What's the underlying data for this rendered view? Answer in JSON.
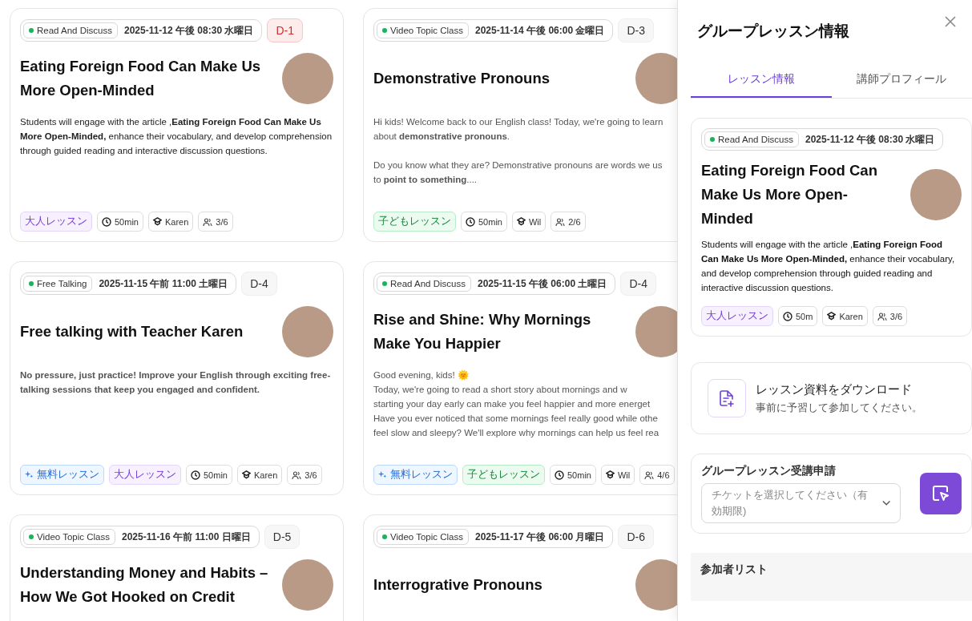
{
  "cards": [
    {
      "type": "Read And Discuss",
      "datetime": "2025-11-12 午後 08:30 水曜日",
      "countdown": "D-1",
      "urgent": true,
      "title": "Eating Foreign Food Can Make Us More Open-Minded",
      "emphasis": false,
      "paragraphs": [
        "Students will engage with the article ,**Eating Foreign Food Can Make Us More Open-Minded,** enhance  their vocabulary, and develop comprehension through guided reading and interactive discussion questions."
      ],
      "tags": [
        {
          "kind": "adult",
          "label": "大人レッスン"
        }
      ],
      "duration": "50min",
      "teacher": "Karen",
      "capacity": "3/6"
    },
    {
      "type": "Video Topic Class",
      "datetime": "2025-11-14 午後 06:00 金曜日",
      "countdown": "D-3",
      "urgent": false,
      "title": "Demonstrative Pronouns",
      "emphasis": false,
      "paragraphs": [
        "Hi kids! Welcome back to our English class! Today, we're going to learn\nabout **demonstrative pronouns**.",
        "Do you know what they are? Demonstrative pronouns are words we us\nto **point to something**...."
      ],
      "tags": [
        {
          "kind": "kids",
          "label": "子どもレッスン"
        }
      ],
      "duration": "50min",
      "teacher": "Wil",
      "capacity": "2/6"
    },
    {
      "type": "Free Talking",
      "datetime": "2025-11-15 午前 11:00 土曜日",
      "countdown": "D-4",
      "urgent": false,
      "title": "Free talking with Teacher Karen",
      "emphasis": true,
      "paragraphs": [
        "No pressure, just practice! Improve your English through exciting free-talking sessions that keep you engaged and confident."
      ],
      "tags": [
        {
          "kind": "free",
          "label": "無料レッスン"
        },
        {
          "kind": "adult",
          "label": "大人レッスン"
        }
      ],
      "duration": "50min",
      "teacher": "Karen",
      "capacity": "3/6"
    },
    {
      "type": "Read And Discuss",
      "datetime": "2025-11-15 午後 06:00 土曜日",
      "countdown": "D-4",
      "urgent": false,
      "title": "Rise and Shine: Why Mornings Make You Happier",
      "emphasis": false,
      "paragraphs": [
        "Good evening, kids! 🌞\nToday, we're going to read a short story about mornings and w\nstarting your day early can make you feel happier and more energet\nHave you ever noticed that some mornings feel really good while othe\nfeel slow and sleepy? We'll explore why mornings can help us feel rea"
      ],
      "tags": [
        {
          "kind": "free",
          "label": "無料レッスン"
        },
        {
          "kind": "kids",
          "label": "子どもレッスン"
        }
      ],
      "duration": "50min",
      "teacher": "Wil",
      "capacity": "4/6"
    },
    {
      "type": "Video Topic Class",
      "datetime": "2025-11-16 午前 11:00 日曜日",
      "countdown": "D-5",
      "urgent": false,
      "title": "Understanding Money and Habits – How We Got Hooked on Credit"
    },
    {
      "type": "Video Topic Class",
      "datetime": "2025-11-17 午後 06:00 月曜日",
      "countdown": "D-6",
      "urgent": false,
      "title": "Interrogrative Pronouns"
    }
  ],
  "panel": {
    "title": "グループレッスン情報",
    "tabs": [
      {
        "label": "レッスン情報",
        "selected": true
      },
      {
        "label": "講師プロフィール",
        "selected": false
      }
    ],
    "lesson": {
      "type": "Read And Discuss",
      "datetime": "2025-11-12 午後 08:30 水曜日",
      "title": "Eating Foreign Food Can Make Us More Open-Minded",
      "description": "Students will engage with the article ,**Eating Foreign Food Can Make Us More Open-Minded,** enhance  their vocabulary, and develop comprehension through guided reading and interactive discussion questions.",
      "tags": [
        {
          "kind": "adult",
          "label": "大人レッスン"
        }
      ],
      "duration": "50m",
      "teacher": "Karen",
      "capacity": "3/6"
    },
    "download": {
      "title": "レッスン資料をダウンロード",
      "subtitle": "事前に予習して参加してください。"
    },
    "apply": {
      "title": "グループレッスン受講申請",
      "placeholder": "チケットを選択してください（有効期限)"
    },
    "participants": {
      "title": "参加者リスト"
    }
  }
}
